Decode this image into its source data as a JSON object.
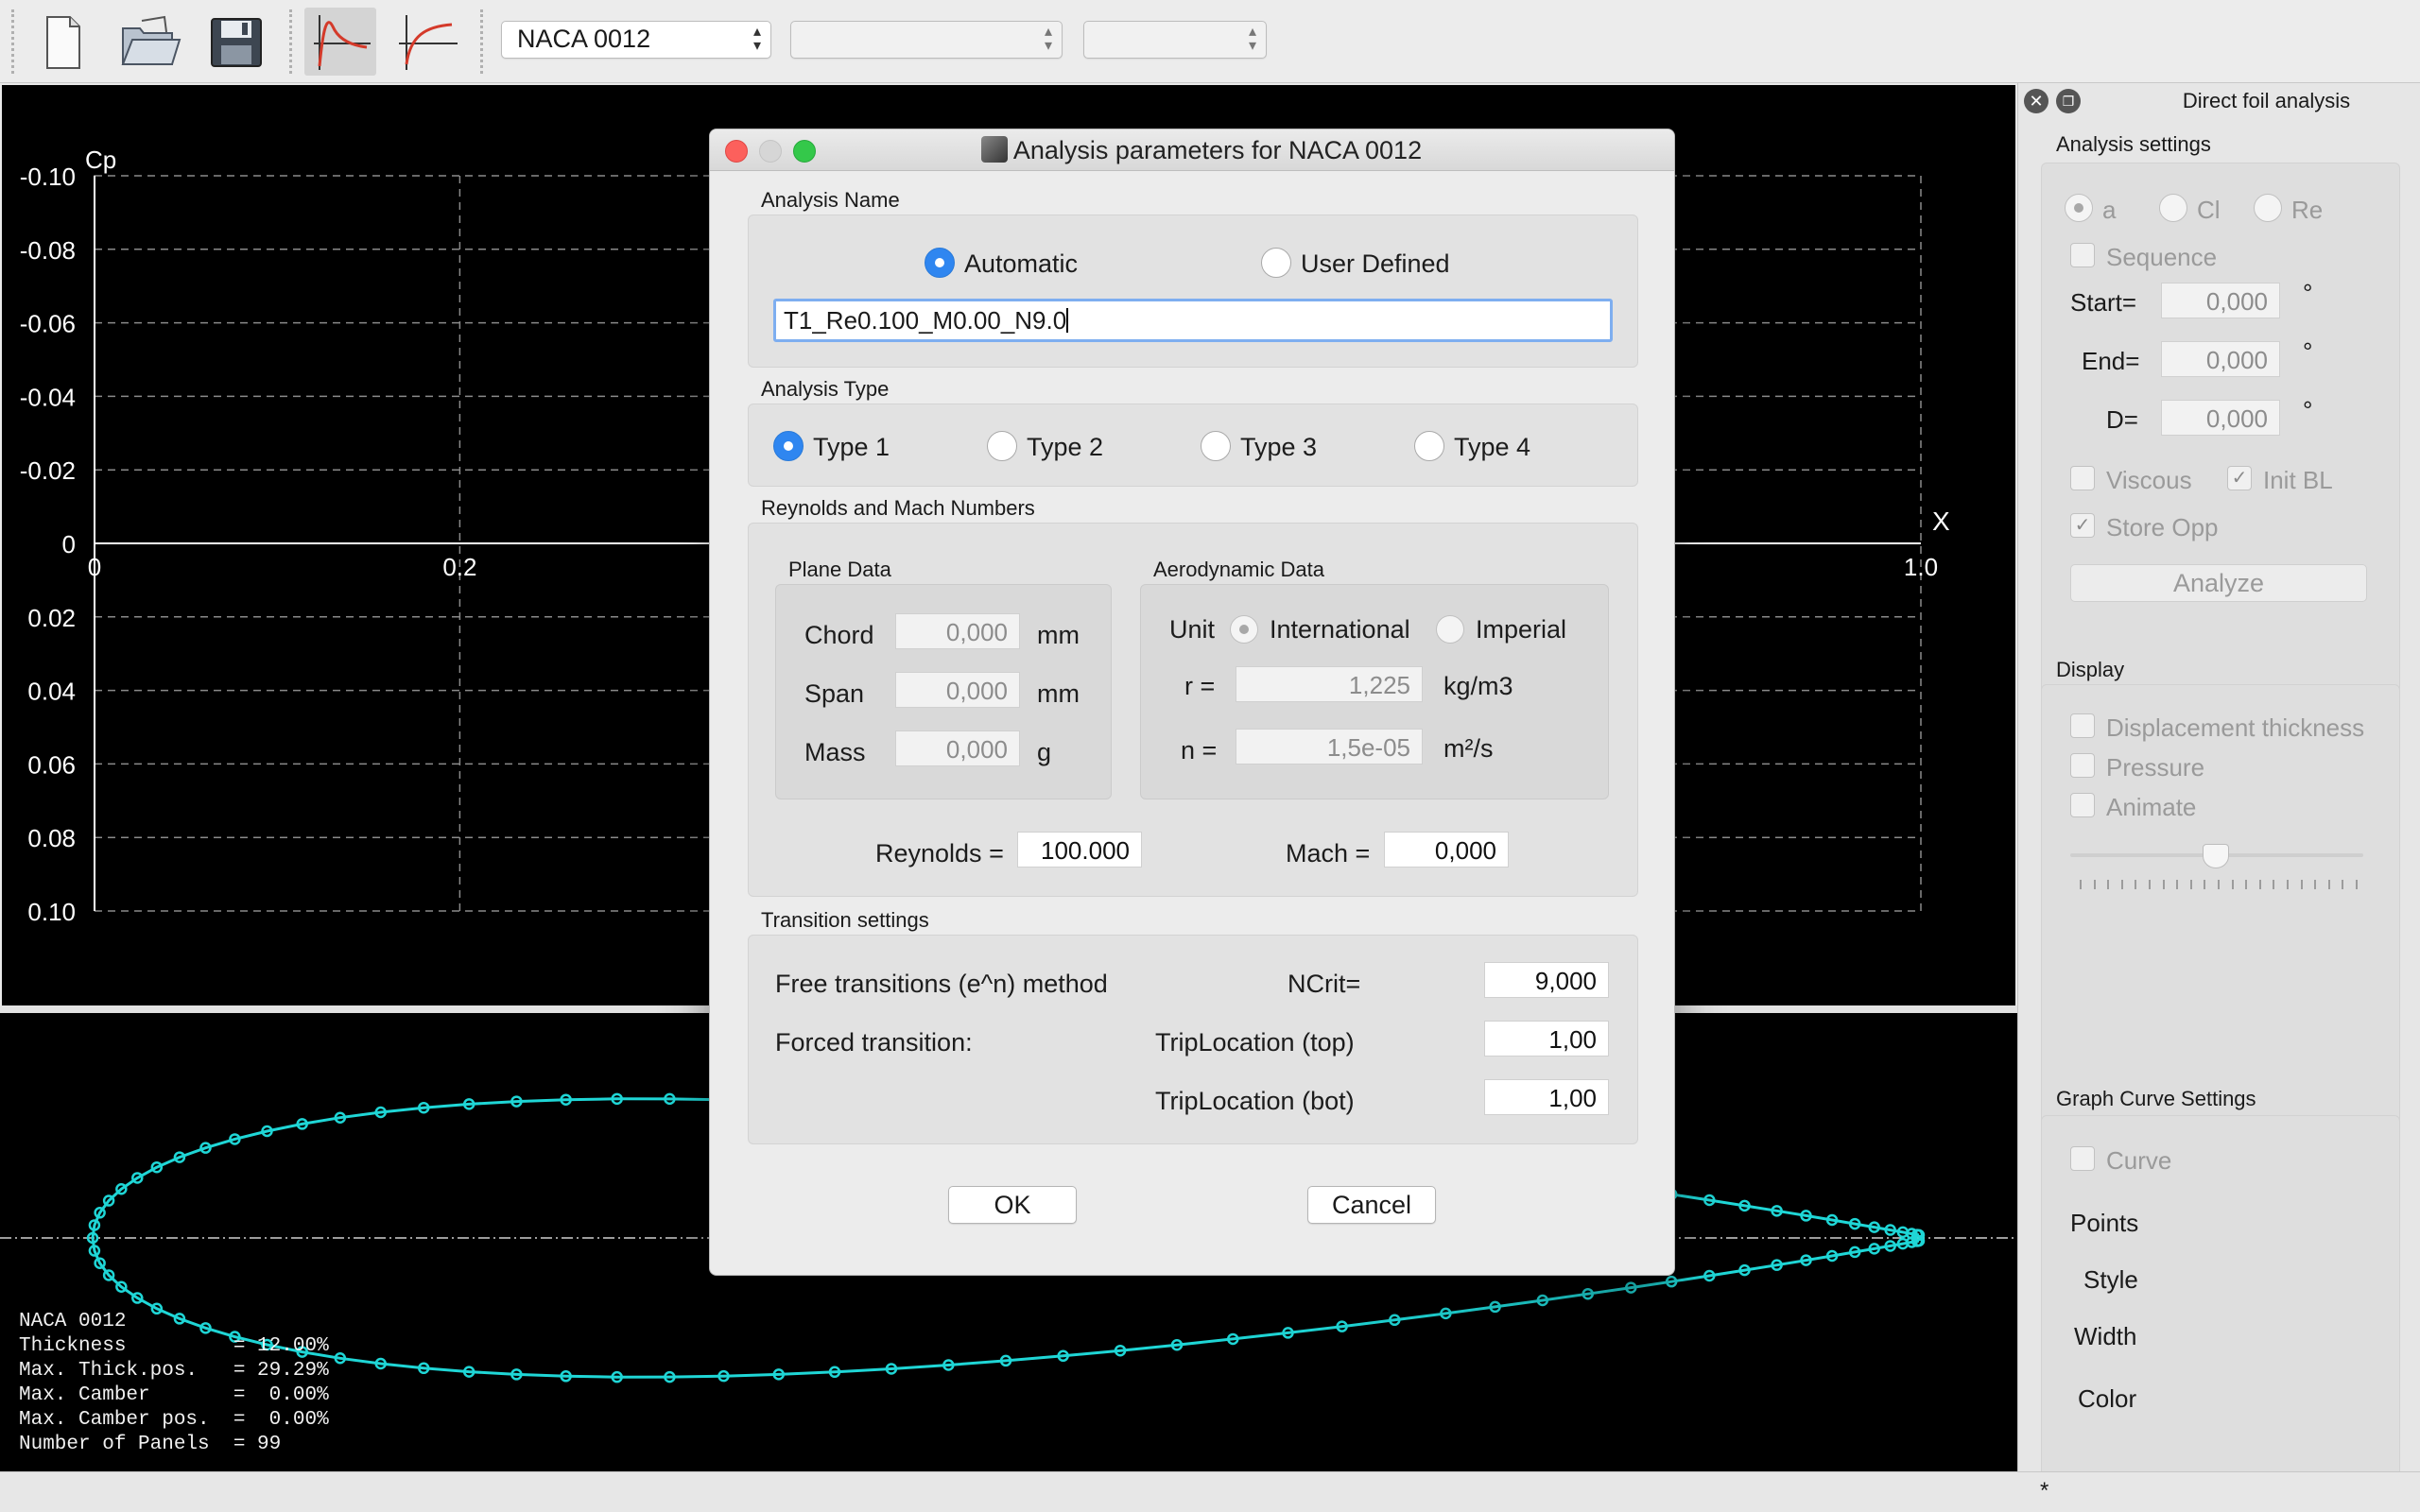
{
  "toolbar": {
    "foil_combo": "NACA 0012",
    "polar_combo": "",
    "opp_combo": "",
    "icons": [
      "new-file-icon",
      "open-folder-icon",
      "save-disk-icon",
      "cp-view-icon",
      "bl-view-icon"
    ]
  },
  "cp_graph": {
    "ylabel": "Cp",
    "xlabel": "X",
    "y_ticks": [
      "-0.10",
      "-0.08",
      "-0.06",
      "-0.04",
      "-0.02",
      "0",
      "0.02",
      "0.04",
      "0.06",
      "0.08",
      "0.10"
    ],
    "x_ticks": [
      "0",
      "0.2",
      "1.0"
    ],
    "background": "#000000",
    "grid": "dashed"
  },
  "foil": {
    "color": "#1fd6d6",
    "info": [
      {
        "label": "NACA 0012",
        "value": ""
      },
      {
        "label": "Thickness         =",
        "value": "12.00%"
      },
      {
        "label": "Max. Thick.pos.   =",
        "value": "29.29%"
      },
      {
        "label": "Max. Camber       =",
        "value": " 0.00%"
      },
      {
        "label": "Max. Camber pos.  =",
        "value": " 0.00%"
      },
      {
        "label": "Number of Panels  =",
        "value": "99"
      }
    ]
  },
  "right_panel": {
    "title": "Direct foil analysis",
    "analysis_settings": {
      "title": "Analysis settings",
      "radios": [
        "a",
        "Cl",
        "Re"
      ],
      "sequence": "Sequence",
      "start_label": "Start=",
      "start_value": "0,000",
      "end_label": "End=",
      "end_value": "0,000",
      "delta_label": "D=",
      "delta_value": "0,000",
      "degree": "°",
      "viscous": "Viscous",
      "init_bl": "Init BL",
      "store_opp": "Store Opp",
      "analyze": "Analyze"
    },
    "display": {
      "title": "Display",
      "displacement": "Displacement thickness",
      "pressure": "Pressure",
      "animate": "Animate"
    },
    "curve": {
      "title": "Graph Curve Settings",
      "curve": "Curve",
      "points": "Points",
      "style": "Style",
      "width": "Width",
      "color": "Color"
    }
  },
  "dialog": {
    "title": "Analysis parameters for NACA 0012",
    "analysis_name": {
      "title": "Analysis Name",
      "automatic": "Automatic",
      "user_defined": "User Defined",
      "selected": "automatic",
      "name_value": "T1_Re0.100_M0.00_N9.0"
    },
    "analysis_type": {
      "title": "Analysis Type",
      "types": [
        "Type 1",
        "Type 2",
        "Type 3",
        "Type 4"
      ],
      "selected": "Type 1"
    },
    "reynolds_mach": {
      "title": "Reynolds and Mach Numbers",
      "plane_data": {
        "title": "Plane Data",
        "chord_label": "Chord",
        "chord_value": "0,000",
        "chord_unit": "mm",
        "span_label": "Span",
        "span_value": "0,000",
        "span_unit": "mm",
        "mass_label": "Mass",
        "mass_value": "0,000",
        "mass_unit": "g"
      },
      "aero_data": {
        "title": "Aerodynamic Data",
        "unit_label": "Unit",
        "international": "International",
        "imperial": "Imperial",
        "rho_label": "r =",
        "rho_value": "1,225",
        "rho_unit": "kg/m3",
        "nu_label": "n =",
        "nu_value": "1,5e-05",
        "nu_unit": "m²/s"
      },
      "reynolds_label": "Reynolds =",
      "reynolds_value": "100.000",
      "mach_label": "Mach =",
      "mach_value": "0,000"
    },
    "transition": {
      "title": "Transition settings",
      "free_label": "Free transitions (e^n) method",
      "ncrit_label": "NCrit=",
      "ncrit_value": "9,000",
      "forced_label": "Forced transition:",
      "trip_top_label": "TripLocation (top)",
      "trip_top_value": "1,00",
      "trip_bot_label": "TripLocation (bot)",
      "trip_bot_value": "1,00"
    },
    "ok": "OK",
    "cancel": "Cancel"
  },
  "statusbar": {
    "text": "*"
  }
}
